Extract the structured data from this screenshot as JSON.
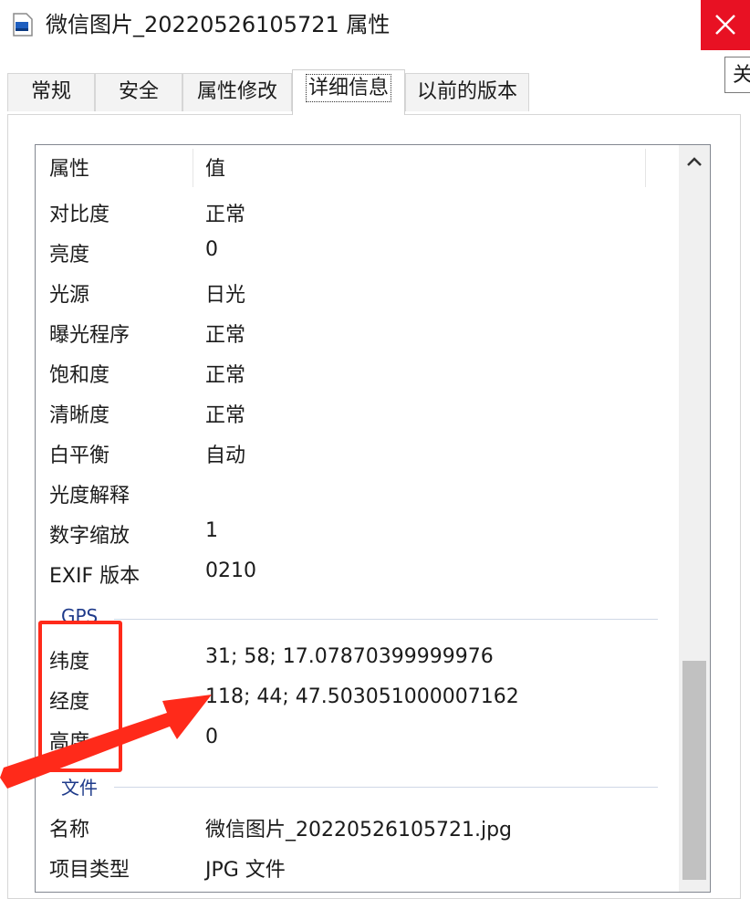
{
  "window": {
    "title": "微信图片_20220526105721 属性",
    "tooltip": "关"
  },
  "tabs": [
    {
      "label": "常规"
    },
    {
      "label": "安全"
    },
    {
      "label": "属性修改"
    },
    {
      "label": "详细信息"
    },
    {
      "label": "以前的版本"
    }
  ],
  "table": {
    "header": {
      "col1": "属性",
      "col2": "值"
    },
    "rows_top": [
      {
        "key": "对比度",
        "value": "正常"
      },
      {
        "key": "亮度",
        "value": "0"
      },
      {
        "key": "光源",
        "value": "日光"
      },
      {
        "key": "曝光程序",
        "value": "正常"
      },
      {
        "key": "饱和度",
        "value": "正常"
      },
      {
        "key": "清晰度",
        "value": "正常"
      },
      {
        "key": "白平衡",
        "value": "自动"
      },
      {
        "key": "光度解释",
        "value": ""
      },
      {
        "key": "数字缩放",
        "value": "1"
      },
      {
        "key": "EXIF 版本",
        "value": "0210"
      }
    ],
    "gps_group": "GPS",
    "gps_rows": [
      {
        "key": "纬度",
        "value": "31; 58; 17.07870399999976"
      },
      {
        "key": "经度",
        "value": "118; 44; 47.503051000007162"
      },
      {
        "key": "高度",
        "value": "0"
      }
    ],
    "file_group": "文件",
    "file_rows": [
      {
        "key": "名称",
        "value": "微信图片_20220526105721.jpg"
      },
      {
        "key": "项目类型",
        "value": "JPG 文件"
      }
    ]
  },
  "colors": {
    "close_button": "#e81123",
    "annotation": "#ff2a1a",
    "group_label": "#1e3a8a"
  }
}
